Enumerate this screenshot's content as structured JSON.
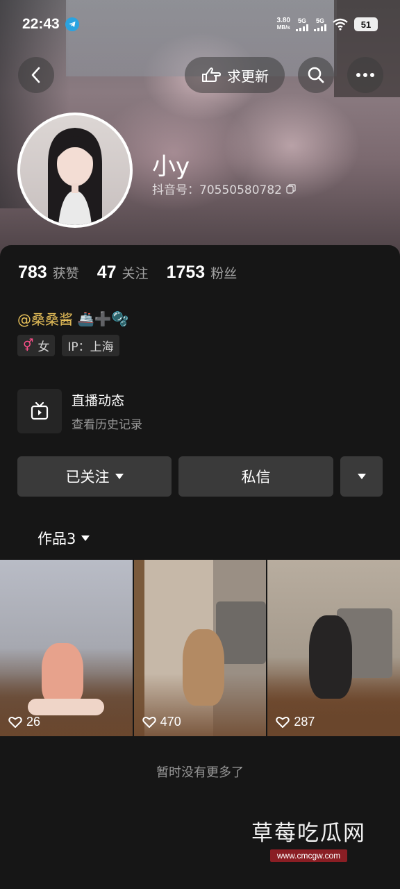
{
  "status_bar": {
    "time": "22:43",
    "net_speed_value": "3.80",
    "net_speed_unit": "MB/s",
    "sim1": "5G",
    "sim2": "5G",
    "battery": "51"
  },
  "nav": {
    "update_label": "求更新"
  },
  "profile": {
    "name": "小y",
    "douyin_id": "抖音号：70550580782",
    "handle": "@桑桑酱",
    "handle_emoji": "🚢➕🫧"
  },
  "stats": [
    {
      "num": "783",
      "label": "获赞"
    },
    {
      "num": "47",
      "label": "关注"
    },
    {
      "num": "1753",
      "label": "粉丝"
    }
  ],
  "tags": {
    "gender_symbol": "⚥",
    "gender": "女",
    "ip": "IP：上海"
  },
  "live": {
    "title": "直播动态",
    "subtitle": "查看历史记录"
  },
  "actions": {
    "follow_label": "已关注",
    "message_label": "私信"
  },
  "works_tab": {
    "label": "作品3"
  },
  "videos": [
    {
      "likes": "26"
    },
    {
      "likes": "470"
    },
    {
      "likes": "287"
    }
  ],
  "footer_note": "暂时没有更多了",
  "watermark": {
    "title": "草莓吃瓜网",
    "url": "www.cmcgw.com"
  },
  "colors": {
    "background": "#161616",
    "button": "#3a3a3a",
    "handle_gold": "#e8c15a",
    "telegram_blue": "#2aa3e0",
    "watermark_red": "#8a1e24"
  }
}
